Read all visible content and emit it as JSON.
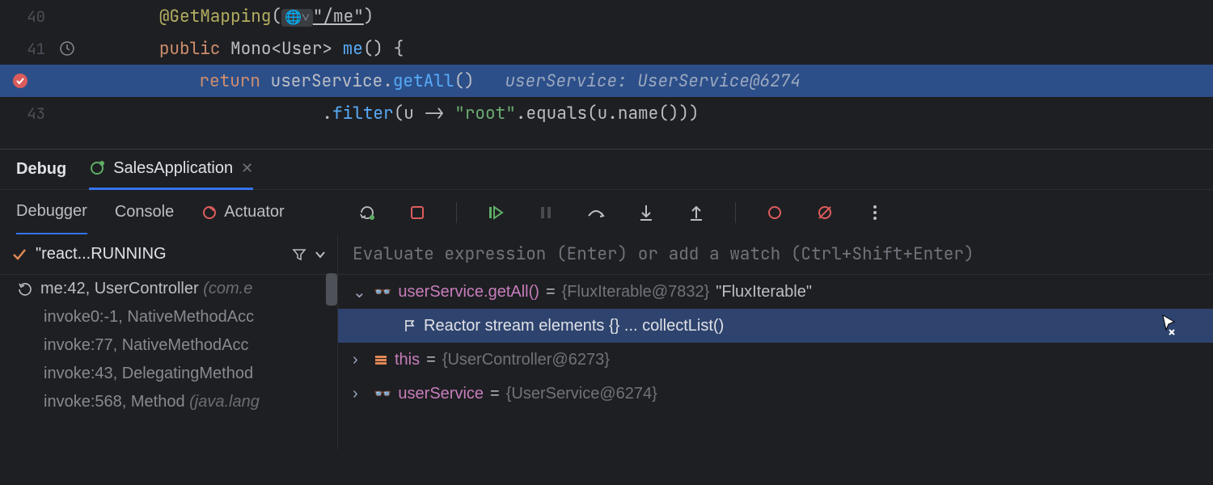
{
  "editor": {
    "lines": [
      {
        "num": "40",
        "code": {
          "ann": "@GetMapping",
          "url": "\"/me\"",
          "close": ")"
        }
      },
      {
        "num": "41",
        "code": {
          "kw": "public",
          "type": " Mono<User> ",
          "fn": "me",
          "sig": "() {"
        }
      },
      {
        "num": "",
        "code": {
          "kw": "return ",
          "svc": "userService",
          "dot": ".",
          "call": "getAll",
          "paren": "()",
          "hint": "userService: UserService@6274"
        }
      },
      {
        "num": "43",
        "code": {
          "dot": ".",
          "fn": "filter",
          "args": "(u -> ",
          "str": "\"root\"",
          "rest": ".equals(u.name()))"
        }
      }
    ]
  },
  "toolTabs": {
    "debug": "Debug",
    "app": "SalesApplication"
  },
  "subTabs": {
    "debugger": "Debugger",
    "console": "Console",
    "actuator": "Actuator"
  },
  "frames": {
    "status": "\"react...RUNNING",
    "items": [
      {
        "top": true,
        "label": "me:42, UserController ",
        "dim": "(com.e"
      },
      {
        "label": "invoke0:-1, NativeMethodAcc"
      },
      {
        "label": "invoke:77, NativeMethodAcc"
      },
      {
        "label": "invoke:43, DelegatingMethod"
      },
      {
        "label": "invoke:568, Method ",
        "dim": "(java.lang"
      }
    ]
  },
  "vars": {
    "placeholder": "Evaluate expression (Enter) or add a watch (Ctrl+Shift+Enter)",
    "rows": [
      {
        "expand": true,
        "glasses": true,
        "name": "userService.getAll()",
        "val": "{FluxIterable@7832}",
        "str": " \"FluxIterable\""
      },
      {
        "indent": true,
        "flag": true,
        "text": "Reactor stream elements {}  ... collectList()"
      },
      {
        "expand": false,
        "field": true,
        "name": "this",
        "val": "{UserController@6273}"
      },
      {
        "expand": false,
        "glasses": true,
        "name": "userService",
        "val": "{UserService@6274}"
      }
    ]
  }
}
